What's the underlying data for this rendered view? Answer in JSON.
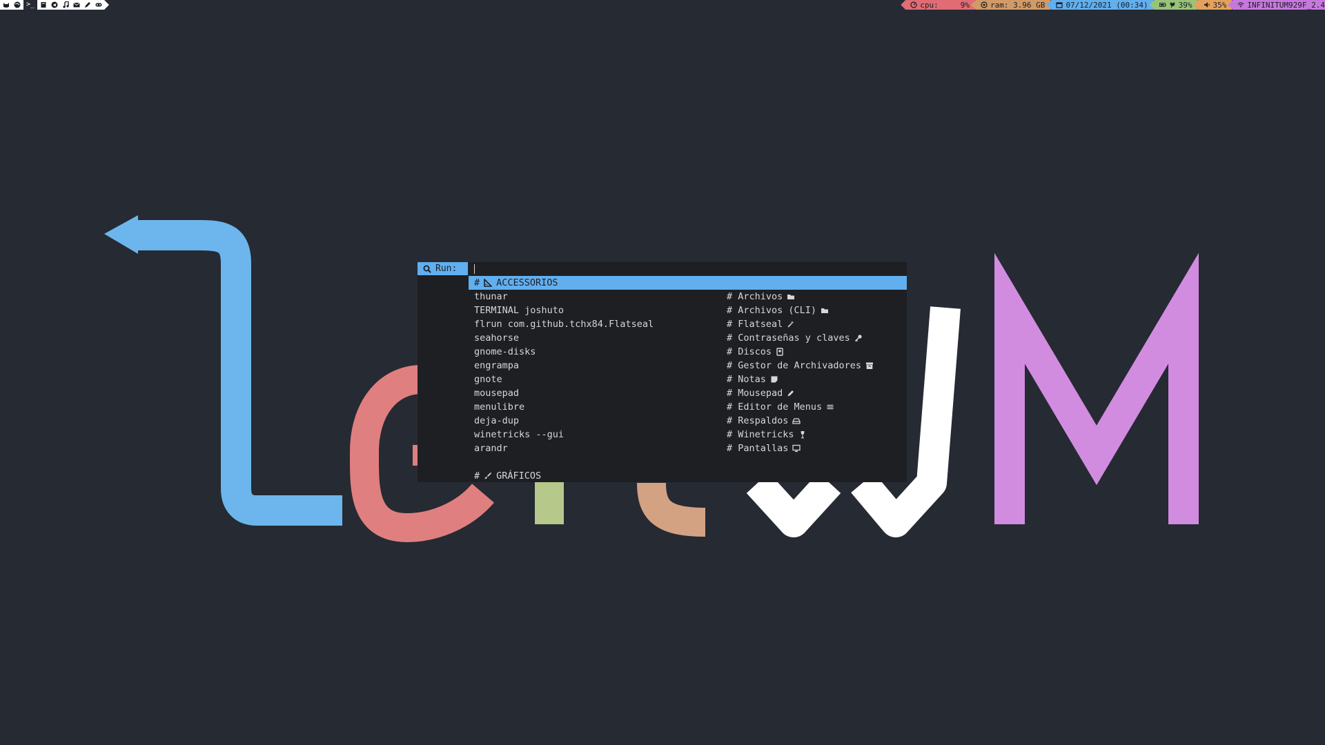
{
  "topbar": {
    "left_icons": [
      "cat-icon",
      "globe-icon",
      "terminal-icon",
      "book-icon",
      "telegram-icon",
      "music-icon",
      "mail-icon",
      "pencil-icon",
      "gamepad-icon"
    ],
    "terminal_glyph": ">_",
    "cpu": {
      "label": "cpu:",
      "value": "9%"
    },
    "ram": {
      "label": "ram: 3.96 GB"
    },
    "date": {
      "label": "07/12/2021 (00:34)"
    },
    "battery": {
      "value": "39%"
    },
    "volume": {
      "value": "35%"
    },
    "wifi": {
      "ssid": "INFINITUM929F_2.4"
    },
    "colors": {
      "cpu": "#e06c75",
      "ram": "#d19a66",
      "date": "#61afef",
      "battery": "#98c379",
      "volume": "#e5a15b",
      "wifi": "#c678dd"
    }
  },
  "wallpaper": {
    "logo_text": "LeftWM",
    "colors": {
      "L": "#6cb6ed",
      "e": "#e07f7f",
      "f": "#b6c88a",
      "t": "#d3a283",
      "W": "#ffffff",
      "M": "#d18ce0"
    }
  },
  "rofi": {
    "prompt": "Run:",
    "input_value": "",
    "rows": [
      {
        "type": "header",
        "hash": "#",
        "icon": "ruler-icon",
        "label": "ACCESSORIOS",
        "selected": true
      },
      {
        "type": "entry",
        "cmd": "thunar",
        "desc": "# Archivos",
        "icon": "folder-icon"
      },
      {
        "type": "entry",
        "cmd": "TERMINAL joshuto",
        "desc": "# Archivos (CLI)",
        "icon": "folder-icon"
      },
      {
        "type": "entry",
        "cmd": "flrun com.github.tchx84.Flatseal",
        "desc": "# Flatseal",
        "icon": "magic-wand-icon"
      },
      {
        "type": "entry",
        "cmd": "seahorse",
        "desc": "# Contraseñas y claves",
        "icon": "key-icon"
      },
      {
        "type": "entry",
        "cmd": "gnome-disks",
        "desc": "# Discos",
        "icon": "hard-drive-icon"
      },
      {
        "type": "entry",
        "cmd": "engrampa",
        "desc": "# Gestor de Archivadores",
        "icon": "archive-icon"
      },
      {
        "type": "entry",
        "cmd": "gnote",
        "desc": "# Notas",
        "icon": "sticky-note-icon"
      },
      {
        "type": "entry",
        "cmd": "mousepad",
        "desc": "# Mousepad",
        "icon": "pen-icon"
      },
      {
        "type": "entry",
        "cmd": "menulibre",
        "desc": "# Editor de Menus",
        "icon": "menu-lines-icon"
      },
      {
        "type": "entry",
        "cmd": "deja-dup",
        "desc": "# Respaldos",
        "icon": "backup-drive-icon"
      },
      {
        "type": "entry",
        "cmd": "winetricks --gui",
        "desc": "# Winetricks",
        "icon": "wine-glass-icon"
      },
      {
        "type": "entry",
        "cmd": "arandr",
        "desc": "# Pantallas",
        "icon": "monitor-icon"
      },
      {
        "type": "blank"
      },
      {
        "type": "header",
        "hash": "#",
        "icon": "paintbrush-icon",
        "label": "GRÁFICOS",
        "selected": false
      }
    ]
  }
}
